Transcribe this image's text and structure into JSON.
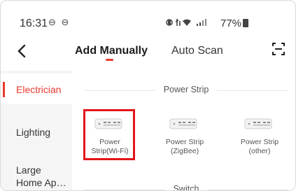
{
  "status_bar": {
    "time": "16:31",
    "notif_icons": "⊖ ⊖",
    "battery": "77%"
  },
  "header": {
    "tabs": [
      {
        "label": "Add Manually",
        "active": true
      },
      {
        "label": "Auto Scan",
        "active": false
      }
    ],
    "accent": "#e83a2f"
  },
  "sidebar": {
    "items": [
      {
        "label": "Electrician",
        "active": true
      },
      {
        "label": "Lighting",
        "active": false
      },
      {
        "label": "Large\nHome Ap…",
        "active": false
      }
    ]
  },
  "sections": [
    {
      "title": "Power Strip"
    },
    {
      "title": "Switch"
    }
  ],
  "devices": [
    {
      "name": "Power\nStrip(Wi-Fi)",
      "highlighted": true,
      "icon": "power-strip-icon"
    },
    {
      "name": "Power Strip\n(ZigBee)",
      "highlighted": false,
      "icon": "power-strip-icon"
    },
    {
      "name": "Power Strip\n(other)",
      "highlighted": false,
      "icon": "power-strip-icon"
    }
  ],
  "colors": {
    "highlight_border": "#e3141b",
    "sidebar_bg": "#f5f5f5"
  }
}
